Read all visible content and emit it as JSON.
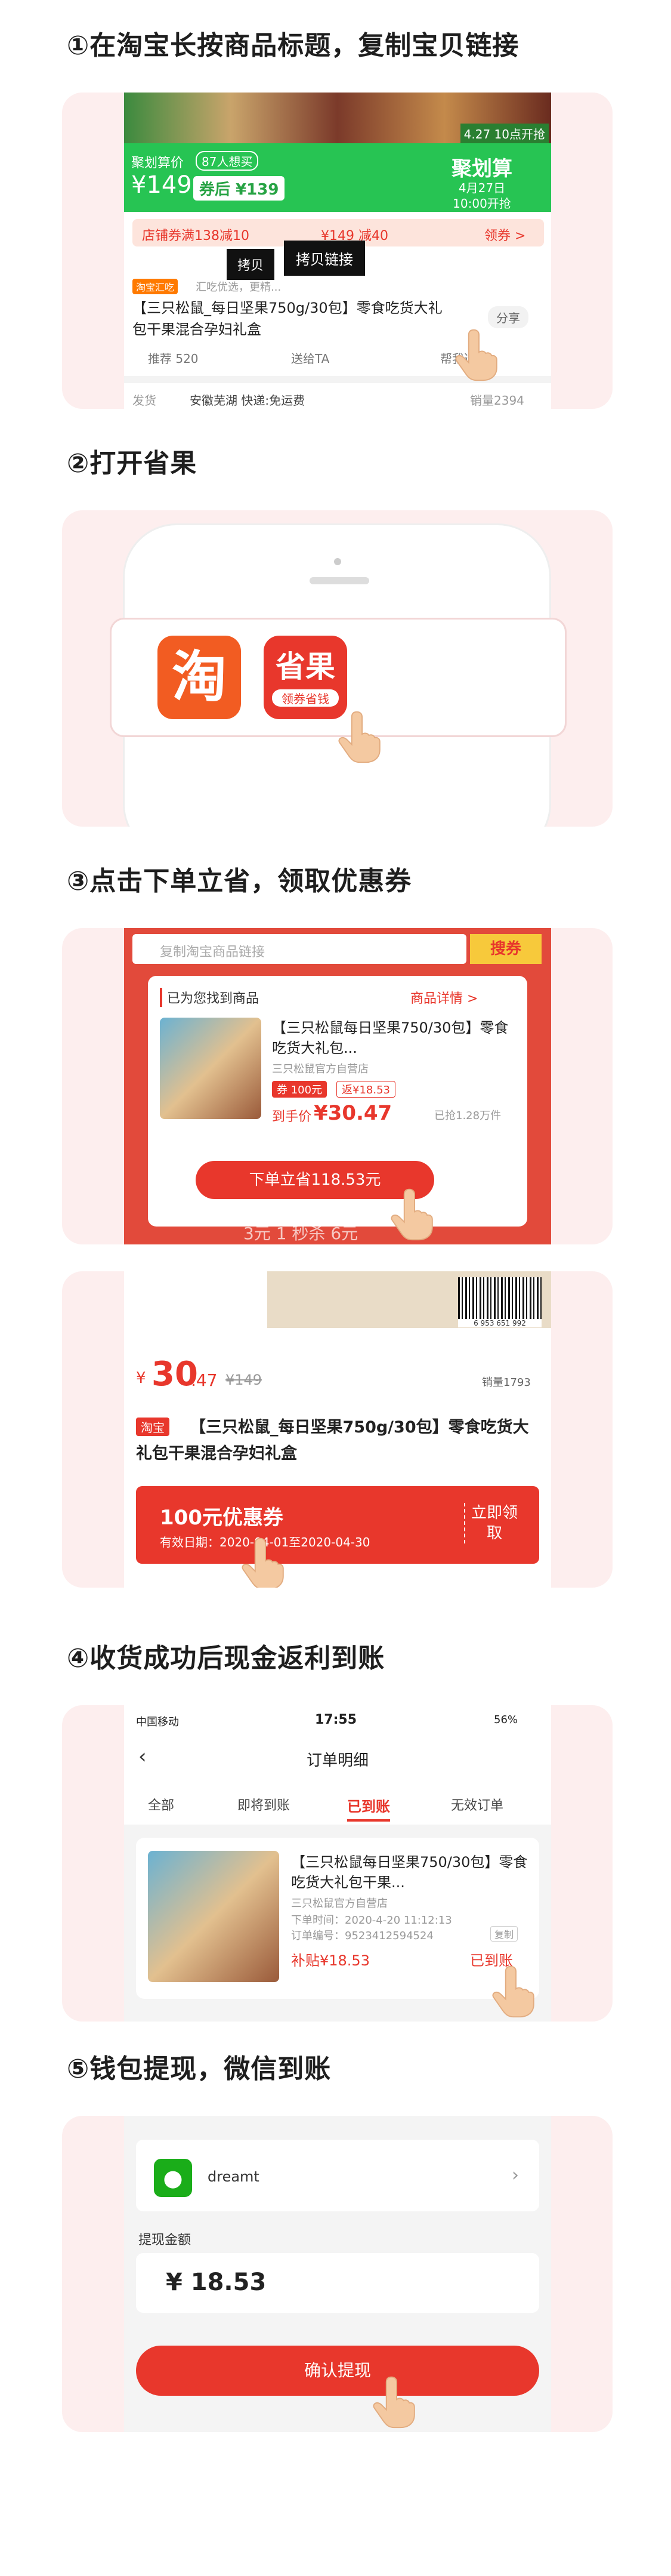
{
  "steps": [
    {
      "title": "①在淘宝长按商品标题，复制宝贝链接"
    },
    {
      "title": "②打开省果"
    },
    {
      "title": "③点击下单立省，领取优惠券"
    },
    {
      "title": "④收货成功后现金返利到账"
    },
    {
      "title": "⑤钱包提现，微信到账"
    }
  ],
  "s1": {
    "juhua_label": "聚划算价",
    "want_count": "87人想买",
    "price": "¥149",
    "coupon_after": "券后 ¥139",
    "juhua_brand": "聚划算",
    "juhua_date": "4月27日",
    "juhua_time": "10:00开抢",
    "badge_top": "4.27 10点开抢",
    "shop_coupon": "店铺券满138减10",
    "price_strike": "¥149 减40",
    "get_label": "领券 >",
    "tip_copy": "拷贝",
    "tip_copy_link": "拷贝链接",
    "tag": "淘宝汇吃",
    "sub": "汇吃优选，更精...",
    "title": "【三只松鼠_每日坚果750g/30包】零食吃货大礼包干果混合孕妇礼盒",
    "share": "分享",
    "recommend": "推荐 520",
    "gift": "送给TA",
    "help": "帮我选",
    "footer_left": "发货",
    "footer_mid": "安徽芜湖 快递:免运费",
    "footer_right": "销量2394"
  },
  "s2": {
    "taobao_char": "淘",
    "app_name": "省果",
    "app_sub": "领券省钱"
  },
  "s3": {
    "search_placeholder": "复制淘宝商品链接",
    "search_btn": "搜券",
    "found": "已为您找到商品",
    "details": "商品详情 >",
    "product_title": "【三只松鼠每日坚果750/30包】零食吃货大礼包...",
    "shop": "三只松鼠官方自营店",
    "coupon_tag": "券 100元",
    "rebate_tag": "返¥18.53",
    "final_label": "到手价",
    "final_price": "¥30.47",
    "sold": "已抢1.28万件",
    "order_btn": "下单立省118.53元",
    "bg_text": "3元    1 秒杀 6元"
  },
  "s3b": {
    "barcode_num": "6 953 651 992",
    "price_big": "30",
    "price_small": ".47",
    "price_strike": "¥149",
    "sales": "销量1793",
    "tb_tag": "淘宝",
    "title": "【三只松鼠_每日坚果750g/30包】零食吃货大礼包干果混合孕妇礼盒",
    "coupon_value": "100元优惠券",
    "coupon_date": "有效日期：2020-04-01至2020-04-30",
    "coupon_btn": "立即领取"
  },
  "s4": {
    "carrier": "中国移动",
    "time": "17:55",
    "battery": "56%",
    "page_title": "订单明细",
    "tabs": [
      "全部",
      "即将到账",
      "已到账",
      "无效订单"
    ],
    "product_title": "【三只松鼠每日坚果750/30包】零食吃货大礼包干果...",
    "shop": "三只松鼠官方自营店",
    "order_time": "下单时间：2020-4-20 11:12:13",
    "order_no": "订单编号：9523412594524",
    "copy": "复制",
    "subsidy": "补贴¥18.53",
    "status": "已到账"
  },
  "s5": {
    "name": "dreamt",
    "amount_label": "提现金额",
    "amount": "¥ 18.53",
    "confirm": "确认提现"
  },
  "colors": {
    "accent": "#e8372c",
    "green": "#27c453",
    "panel": "#fdeeee"
  }
}
